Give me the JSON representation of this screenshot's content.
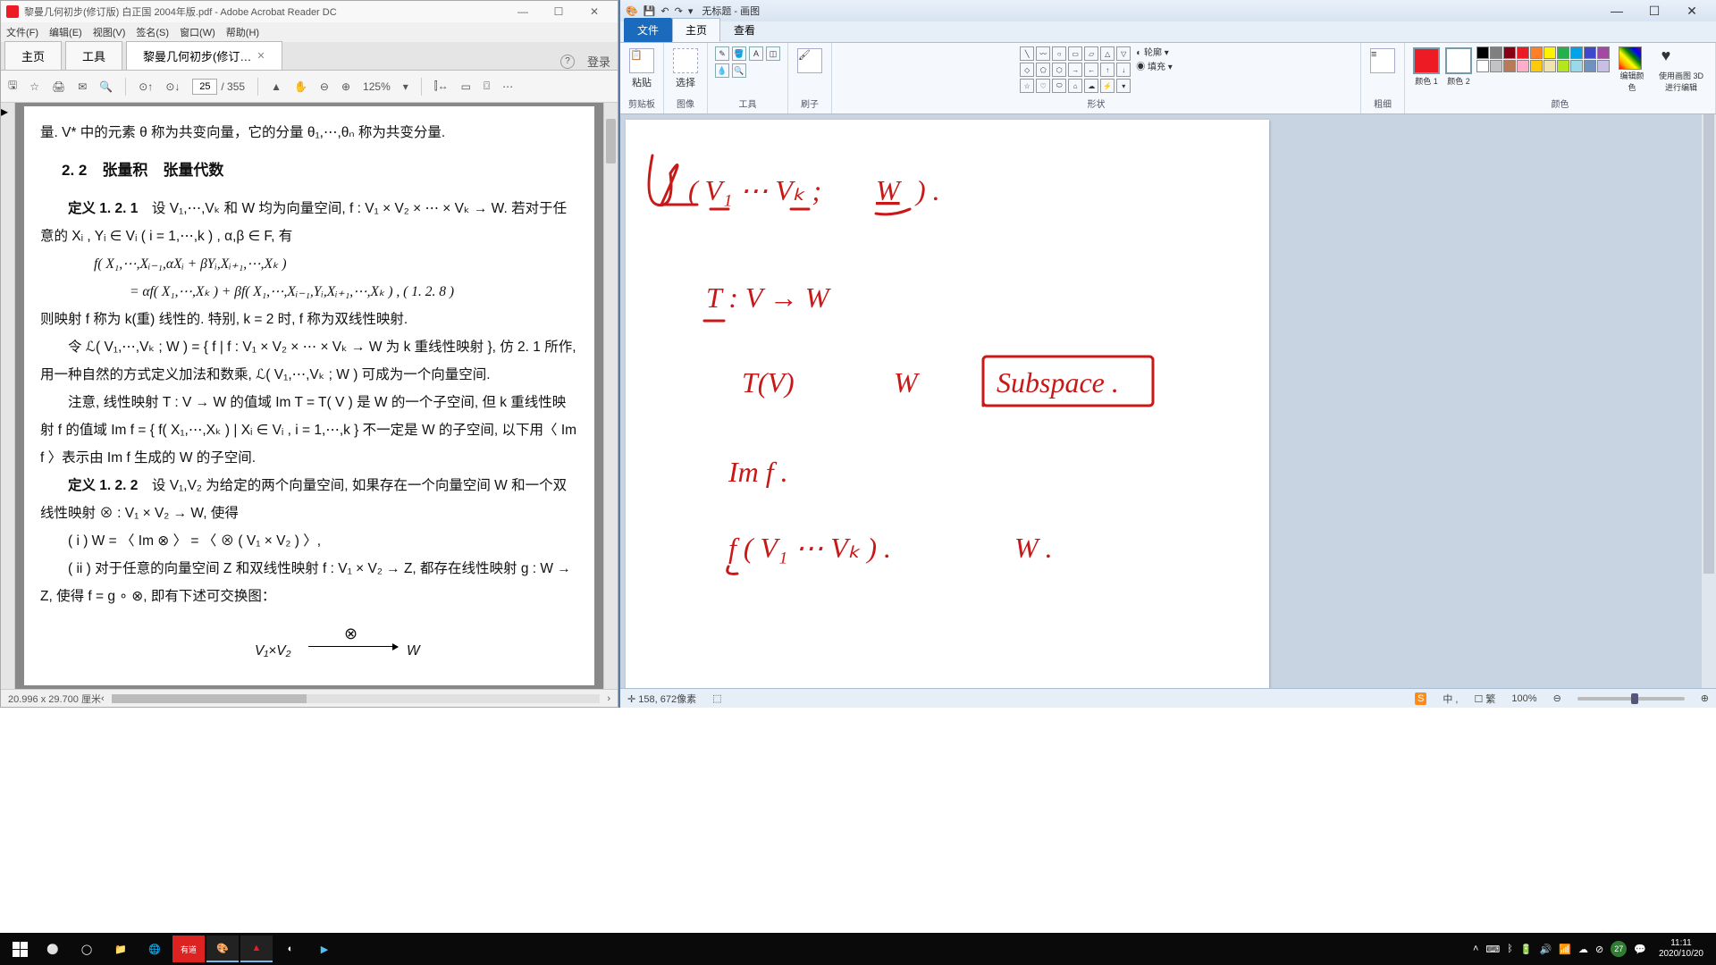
{
  "acrobat": {
    "title": "黎曼几何初步(修订版) 白正国 2004年版.pdf - Adobe Acrobat Reader DC",
    "menu": [
      "文件(F)",
      "编辑(E)",
      "视图(V)",
      "签名(S)",
      "窗口(W)",
      "帮助(H)"
    ],
    "tab_home": "主页",
    "tab_tools": "工具",
    "doc_tab": "黎曼几何初步(修订…",
    "login": "登录",
    "page_current": "25",
    "page_total": "/ 355",
    "zoom": "125%",
    "status": "20.996 x 29.700 厘米",
    "content": {
      "line0": "量. V* 中的元素 θ 称为共变向量，它的分量 θ₁,⋯,θₙ 称为共变分量.",
      "section": "2. 2　张量积　张量代数",
      "def1_title": "定义 1. 2. 1",
      "def1_body": "　设 V₁,⋯,Vₖ 和 W 均为向量空间, f : V₁ × V₂ × ⋯ × Vₖ → W. 若对于任意的 Xᵢ , Yᵢ ∈ Vᵢ ( i = 1,⋯,k ) , α,β ∈ F, 有",
      "formula1": "f( X₁,⋯,Xᵢ₋₁,αXᵢ + βYᵢ,Xᵢ₊₁,⋯,Xₖ )",
      "formula2": "= αf( X₁,⋯,Xₖ ) + βf( X₁,⋯,Xᵢ₋₁,Yᵢ,Xᵢ₊₁,⋯,Xₖ ) , ( 1. 2. 8 )",
      "para1": "则映射 f 称为 k(重) 线性的. 特别, k = 2 时, f 称为双线性映射.",
      "para2": "令 ℒ( V₁,⋯,Vₖ ; W ) = { f | f : V₁ × V₂ × ⋯ × Vₖ → W 为 k 重线性映射 }, 仿 2. 1 所作, 用一种自然的方式定义加法和数乘, ℒ( V₁,⋯,Vₖ ; W ) 可成为一个向量空间.",
      "para3": "注意, 线性映射 T : V → W 的值域 Im T = T( V ) 是 W 的一个子空间, 但 k 重线性映射 f 的值域 Im f = { f( X₁,⋯,Xₖ ) | Xᵢ ∈ Vᵢ , i = 1,⋯,k } 不一定是 W 的子空间, 以下用〈 Im f 〉表示由 Im f 生成的 W 的子空间.",
      "def2_title": "定义 1. 2. 2",
      "def2_body": "　设 V₁,V₂ 为给定的两个向量空间, 如果存在一个向量空间 W 和一个双线性映射 ⊗ : V₁ × V₂ → W, 使得",
      "item_i": "( i )  W = 〈 Im ⊗ 〉 = 〈 ⊗ ( V₁ × V₂ ) 〉,",
      "item_ii": "( ii ) 对于任意的向量空间 Z 和双线性映射 f : V₁ × V₂ → Z, 都存在线性映射 g : W → Z, 使得 f = g ∘ ⊗, 即有下述可交换图：",
      "diag_left": "V₁×V₂",
      "diag_right": "W",
      "diag_top": "⊗"
    }
  },
  "paint": {
    "title": "无标题 - 画图",
    "tabs": {
      "file": "文件",
      "home": "主页",
      "view": "查看"
    },
    "groups": {
      "clipboard": "剪贴板",
      "paste": "粘贴",
      "image": "图像",
      "select": "选择",
      "tools": "工具",
      "brushes": "刷子",
      "shapes": "形状",
      "outline": "轮廓",
      "fill": "填充",
      "size": "粗细",
      "color1": "颜色 1",
      "color2": "颜色 2",
      "colors": "颜色",
      "edit_colors": "编辑颜色",
      "paint3d": "使用画图 3D 进行编辑"
    },
    "palette_row1": [
      "#000000",
      "#7f7f7f",
      "#880015",
      "#ed1c24",
      "#ff7f27",
      "#fff200",
      "#22b14c",
      "#00a2e8",
      "#3f48cc",
      "#a349a4"
    ],
    "palette_row2": [
      "#ffffff",
      "#c3c3c3",
      "#b97a57",
      "#ffaec9",
      "#ffc90e",
      "#efe4b0",
      "#b5e61d",
      "#99d9ea",
      "#7092be",
      "#c8bfe7"
    ],
    "active_color1": "#ed1c24",
    "active_color2": "#ffffff",
    "canvas_text": {
      "line1": "ℒ( V₁ ⋯ Vₖ ; W ) .",
      "line2": "T : V → W",
      "line3a": "T(V)",
      "line3b": "W",
      "line3c": "Subspace .",
      "line4": "Im f .",
      "line5a": "f ( V₁ ⋯ Vₖ ) .",
      "line5b": "W ."
    },
    "status": {
      "coords": "158, 672像素",
      "ime": "中 ,",
      "ime2": "☐ 繁",
      "zoom": "100%"
    }
  },
  "taskbar": {
    "time": "11:11",
    "date": "2020/10/20",
    "badge": "27"
  }
}
